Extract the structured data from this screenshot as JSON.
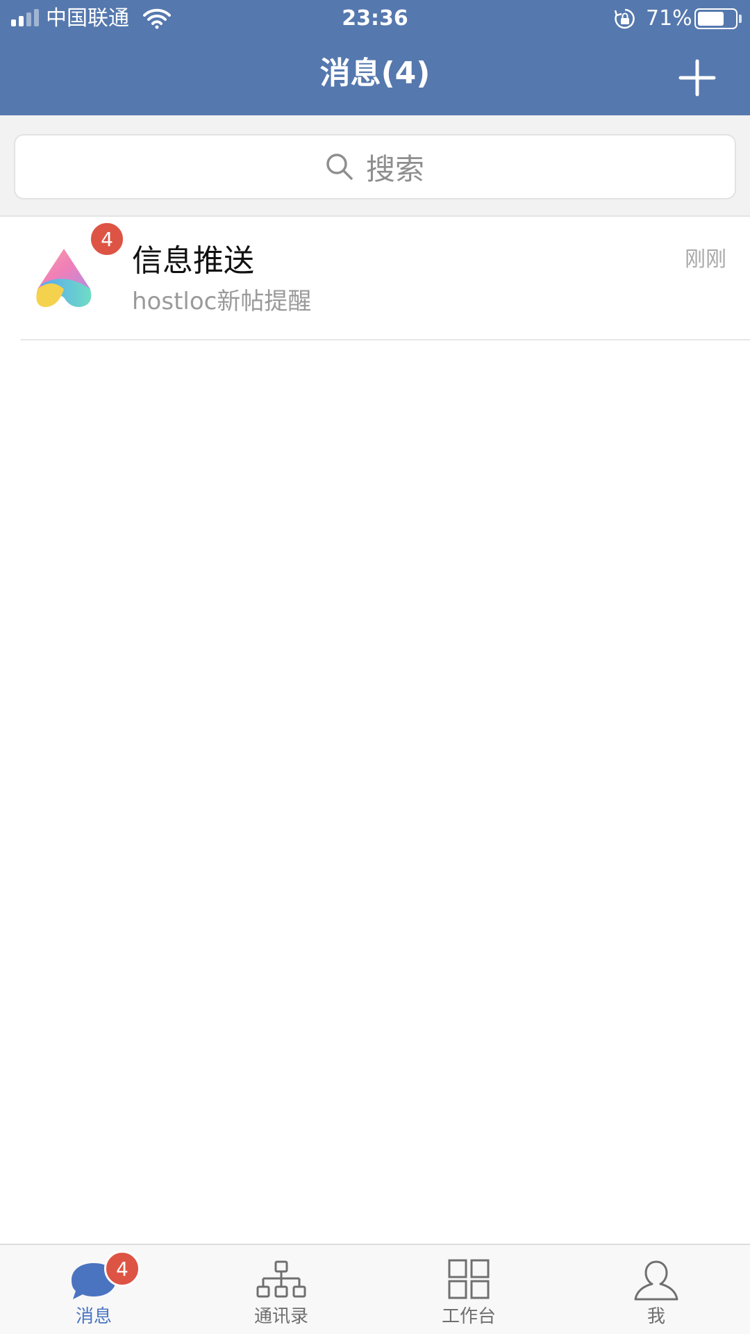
{
  "status_bar": {
    "carrier": "中国联通",
    "time": "23:36",
    "battery_percent": "71%",
    "battery_level": 0.71,
    "signal_bars": 2,
    "signal_bars_total": 4
  },
  "header": {
    "title": "消息(4)",
    "add_icon": "plus-icon"
  },
  "search": {
    "placeholder": "搜索",
    "icon": "search-icon"
  },
  "messages": [
    {
      "title": "信息推送",
      "preview": "hostloc新帖提醒",
      "time": "刚刚",
      "badge": "4"
    }
  ],
  "tabs": [
    {
      "label": "消息",
      "icon": "chat-bubble-icon",
      "badge": "4",
      "active": true
    },
    {
      "label": "通讯录",
      "icon": "org-chart-icon",
      "active": false
    },
    {
      "label": "工作台",
      "icon": "grid-icon",
      "active": false
    },
    {
      "label": "我",
      "icon": "person-icon",
      "active": false
    }
  ],
  "colors": {
    "header_bg": "#5578ae",
    "accent": "#4a74c0",
    "badge": "#dd5444"
  }
}
